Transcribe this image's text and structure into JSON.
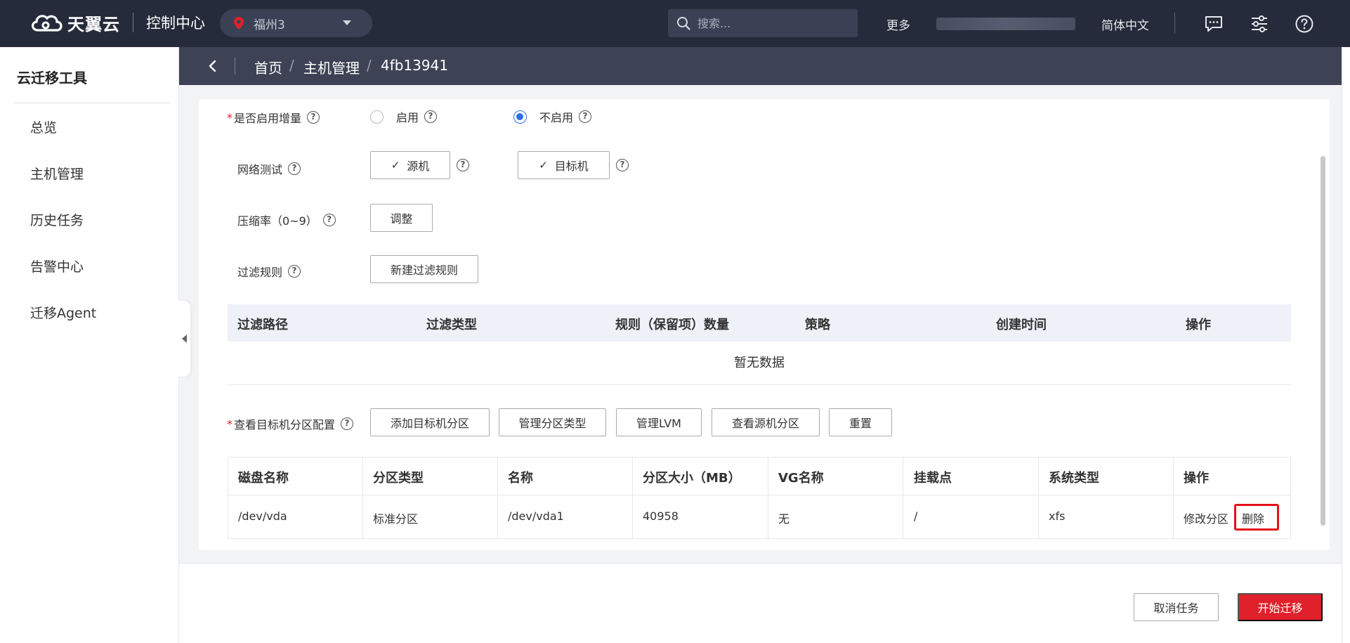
{
  "header": {
    "brand": "天翼云",
    "console": "控制中心",
    "region": "福州3",
    "search_placeholder": "搜索...",
    "more": "更多",
    "language": "简体中文"
  },
  "sidebar": {
    "title": "云迁移工具",
    "items": [
      {
        "label": "总览"
      },
      {
        "label": "主机管理"
      },
      {
        "label": "历史任务"
      },
      {
        "label": "告警中心"
      },
      {
        "label": "迁移Agent"
      }
    ]
  },
  "breadcrumb": {
    "items": [
      "首页",
      "主机管理",
      "4fb13941"
    ],
    "separator": "/"
  },
  "form": {
    "incremental": {
      "label": "是否启用增量",
      "options": [
        "启用",
        "不启用"
      ],
      "selected": "不启用"
    },
    "network_test": {
      "label": "网络测试",
      "source": "源机",
      "target": "目标机"
    },
    "compression": {
      "label": "压缩率（0~9）",
      "button": "调整"
    },
    "filter_rules": {
      "label": "过滤规则",
      "button": "新建过滤规则",
      "columns": [
        "过滤路径",
        "过滤类型",
        "规则（保留项）数量",
        "策略",
        "创建时间",
        "操作"
      ],
      "empty_text": "暂无数据"
    },
    "partition": {
      "label": "查看目标机分区配置",
      "buttons": [
        "添加目标机分区",
        "管理分区类型",
        "管理LVM",
        "查看源机分区",
        "重置"
      ],
      "columns": [
        "磁盘名称",
        "分区类型",
        "名称",
        "分区大小（MB）",
        "VG名称",
        "挂载点",
        "系统类型",
        "操作"
      ],
      "rows": [
        {
          "disk": "/dev/vda",
          "type": "标准分区",
          "name": "/dev/vda1",
          "size": "40958",
          "vg": "无",
          "mount": "/",
          "fs": "xfs",
          "action_edit": "修改分区",
          "action_delete": "删除"
        }
      ]
    }
  },
  "footer": {
    "cancel": "取消任务",
    "start": "开始迁移"
  },
  "colors": {
    "topbar": "#252b3a",
    "crumbbar": "#3d4354",
    "accent_blue": "#2f6fe6",
    "primary_red": "#e0202a",
    "highlight_box": "#e4101a"
  }
}
